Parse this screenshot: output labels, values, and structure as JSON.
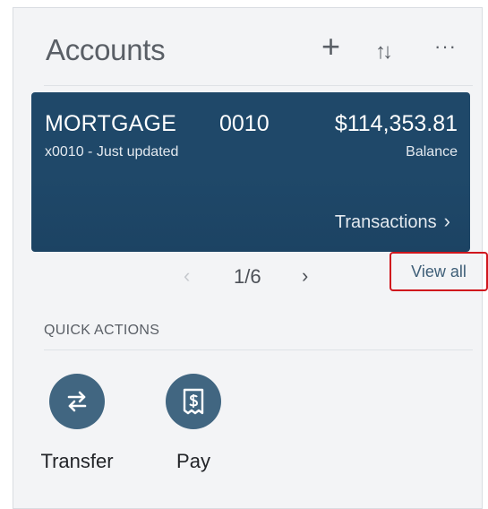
{
  "header": {
    "title": "Accounts",
    "add_icon": "plus-icon",
    "sort_icon": "sort-icon",
    "more_icon": "more-icon",
    "add_glyph": "+",
    "sort_glyph": "↑↓",
    "more_glyph": "···"
  },
  "account_card": {
    "name": "MORTGAGE",
    "number": "0010",
    "amount": "$114,353.81",
    "subtitle": "x0010 - Just updated",
    "balance_label": "Balance",
    "transactions_label": "Transactions",
    "transactions_chevron": "›",
    "background_color": "#1f4869"
  },
  "pager": {
    "prev_glyph": "‹",
    "current": "1/6",
    "next_glyph": "›",
    "view_all_label": "View all",
    "highlight_color": "#d0161d"
  },
  "quick_actions": {
    "section_label": "QUICK ACTIONS",
    "items": [
      {
        "label": "Transfer",
        "icon": "transfer-icon"
      },
      {
        "label": "Pay",
        "icon": "pay-icon"
      }
    ],
    "icon_color": "#416681"
  }
}
